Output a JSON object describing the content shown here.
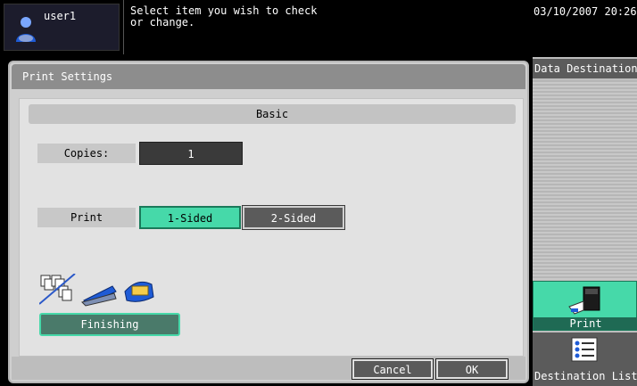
{
  "header": {
    "user_name": "user1",
    "message": "Select item you wish to check\nor change.",
    "datetime": "03/10/2007 20:26"
  },
  "panel": {
    "title": "Print Settings",
    "section": "Basic",
    "copies_label": "Copies:",
    "copies_value": "1",
    "print_label": "Print",
    "print_options": [
      "1-Sided",
      "2-Sided"
    ],
    "print_selected": "1-Sided",
    "finishing_label": "Finishing",
    "cancel_label": "Cancel",
    "ok_label": "OK"
  },
  "sidebar": {
    "title": "Data Destination",
    "tabs": [
      {
        "label": "Print",
        "icon": "printer-icon",
        "active": true
      },
      {
        "label": "Destination List",
        "icon": "list-icon",
        "active": false
      }
    ]
  },
  "colors": {
    "accent_green": "#46d9a9",
    "dark_button": "#5b5b5b",
    "panel_bg": "#cfcfcf"
  }
}
